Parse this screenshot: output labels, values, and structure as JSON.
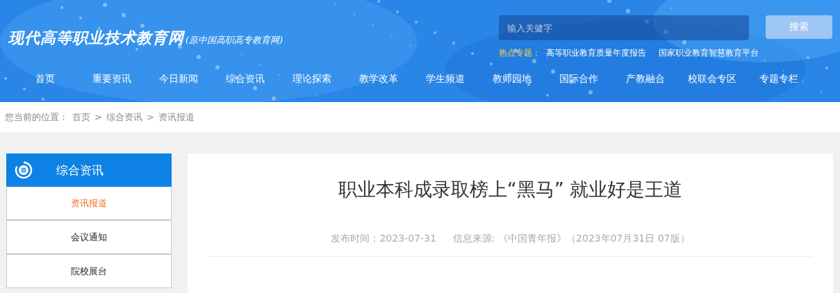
{
  "header": {
    "site_title": "现代高等职业技术教育网",
    "site_subtitle": "(原中国高职高专教育网)",
    "search": {
      "placeholder": "输入关健字",
      "button": "搜索"
    },
    "hot_topics": {
      "label": "热点专题：",
      "links": [
        "高等职业教育质量年度报告",
        "国家职业教育智慧教育平台"
      ]
    }
  },
  "nav": [
    "首页",
    "重要资讯",
    "今日新闻",
    "综合资讯",
    "理论探索",
    "教学改革",
    "学生频道",
    "教师园地",
    "国际合作",
    "产教融合",
    "校联会专区",
    "专题专栏"
  ],
  "breadcrumb": {
    "label": "您当前的位置：",
    "items": [
      "首页",
      "综合资讯",
      "资讯报道"
    ],
    "separator": ">"
  },
  "sidebar": {
    "title": "综合资讯",
    "items": [
      {
        "label": "资讯报道",
        "selected": true
      },
      {
        "label": "会议通知",
        "selected": false
      },
      {
        "label": "院校展台",
        "selected": false
      }
    ]
  },
  "article": {
    "title": "职业本科成录取榜上“黑马” 就业好是王道",
    "meta": [
      "发布时间：2023-07-31",
      "信息来源: 《中国青年报》（2023年07月31日 07版）"
    ]
  }
}
